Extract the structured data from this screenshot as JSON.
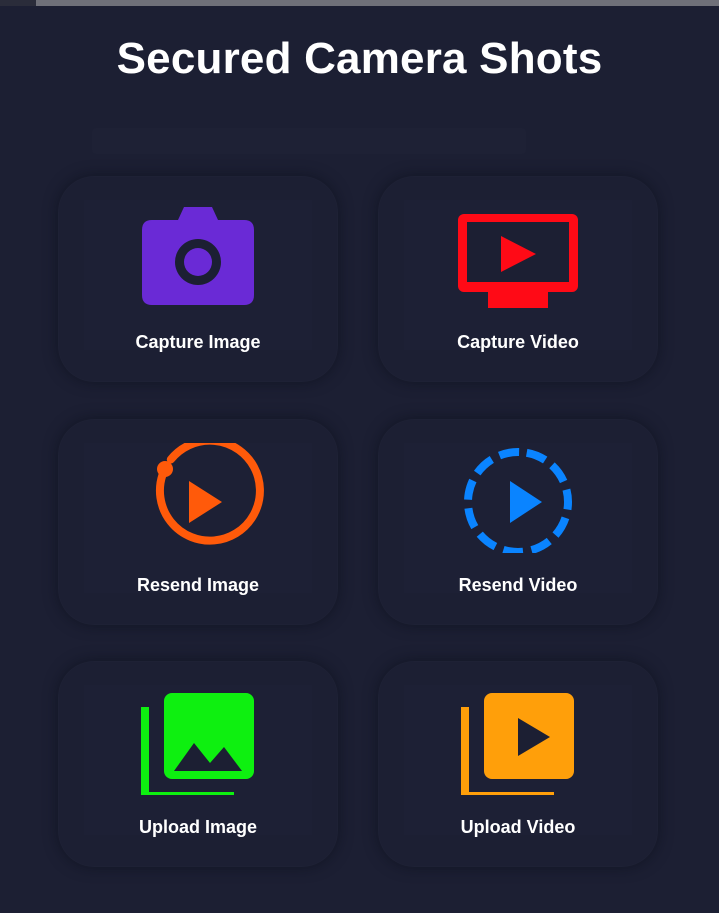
{
  "header": {
    "title": "Secured Camera Shots"
  },
  "tiles": [
    {
      "label": "Capture Image",
      "icon": "camera-icon",
      "color": "#6a2ad6"
    },
    {
      "label": "Capture Video",
      "icon": "tv-play-icon",
      "color": "#ff0a16"
    },
    {
      "label": "Resend Image",
      "icon": "replay-circle-icon",
      "color": "#ff5a0a"
    },
    {
      "label": "Resend Video",
      "icon": "dashed-play-circle-icon",
      "color": "#0a84ff"
    },
    {
      "label": "Upload Image",
      "icon": "image-stack-icon",
      "color": "#0ef010"
    },
    {
      "label": "Upload Video",
      "icon": "video-stack-icon",
      "color": "#ff9f0a"
    }
  ],
  "colors": {
    "background": "#1c1f33",
    "text": "#ffffff"
  }
}
